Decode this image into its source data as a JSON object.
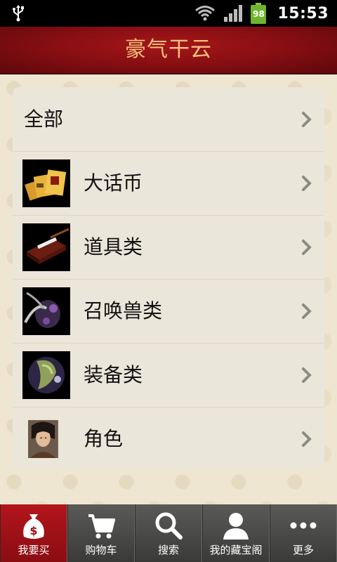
{
  "status_bar": {
    "time": "15:53",
    "battery_level": "98",
    "icons": [
      "usb-icon",
      "wifi-icon",
      "signal-icon",
      "battery-icon"
    ]
  },
  "header": {
    "title": "豪气干云"
  },
  "categories": [
    {
      "label": "全部",
      "icon": null
    },
    {
      "label": "大话币",
      "icon": "currency-cards-icon"
    },
    {
      "label": "道具类",
      "icon": "item-box-icon"
    },
    {
      "label": "召唤兽类",
      "icon": "summon-beast-icon"
    },
    {
      "label": "装备类",
      "icon": "equipment-icon"
    },
    {
      "label": "角色",
      "icon": "character-portrait-icon"
    }
  ],
  "tabs": [
    {
      "label": "我要买",
      "icon": "money-bag-icon",
      "active": true
    },
    {
      "label": "购物车",
      "icon": "cart-icon",
      "active": false
    },
    {
      "label": "搜索",
      "icon": "search-icon",
      "active": false
    },
    {
      "label": "我的藏宝阁",
      "icon": "user-icon",
      "active": false
    },
    {
      "label": "更多",
      "icon": "more-icon",
      "active": false
    }
  ],
  "colors": {
    "header_red": "#8a0f13",
    "title_gold": "#f3c27a",
    "tab_active_red": "#b3151b",
    "tab_bar_gray": "#4a4a48",
    "battery_green": "#6fb52c"
  }
}
